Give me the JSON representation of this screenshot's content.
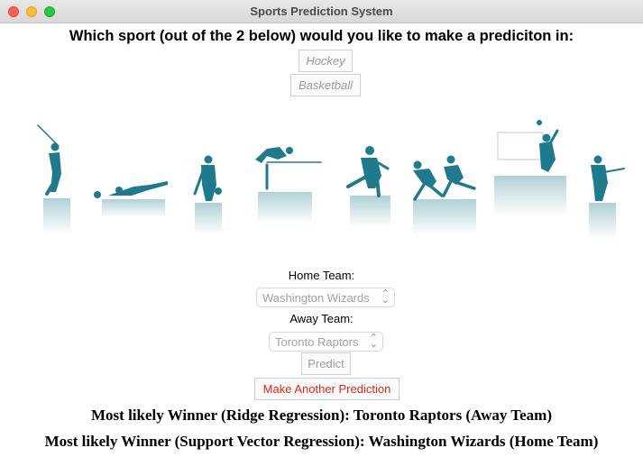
{
  "window": {
    "title": "Sports Prediction System"
  },
  "question": "Which sport (out of the 2 below) would you like to make a prediciton in:",
  "sports": [
    {
      "label": "Hockey"
    },
    {
      "label": "Basketball"
    }
  ],
  "home_team": {
    "label": "Home Team:",
    "value": "Washington Wizards"
  },
  "away_team": {
    "label": "Away Team:",
    "value": "Toronto Raptors"
  },
  "buttons": {
    "predict": "Predict",
    "again": "Make Another Prediction"
  },
  "results": {
    "ridge": "Most likely Winner (Ridge Regression): Toronto Raptors (Away Team)",
    "svr": "Most likely Winner (Support Vector Regression): Washington Wizards (Home Team)"
  },
  "icons": {
    "select_chevron": "up-down-chevron-icon"
  },
  "colors": {
    "silhouette": "#1e7a8c",
    "again_text": "#e0241b"
  }
}
